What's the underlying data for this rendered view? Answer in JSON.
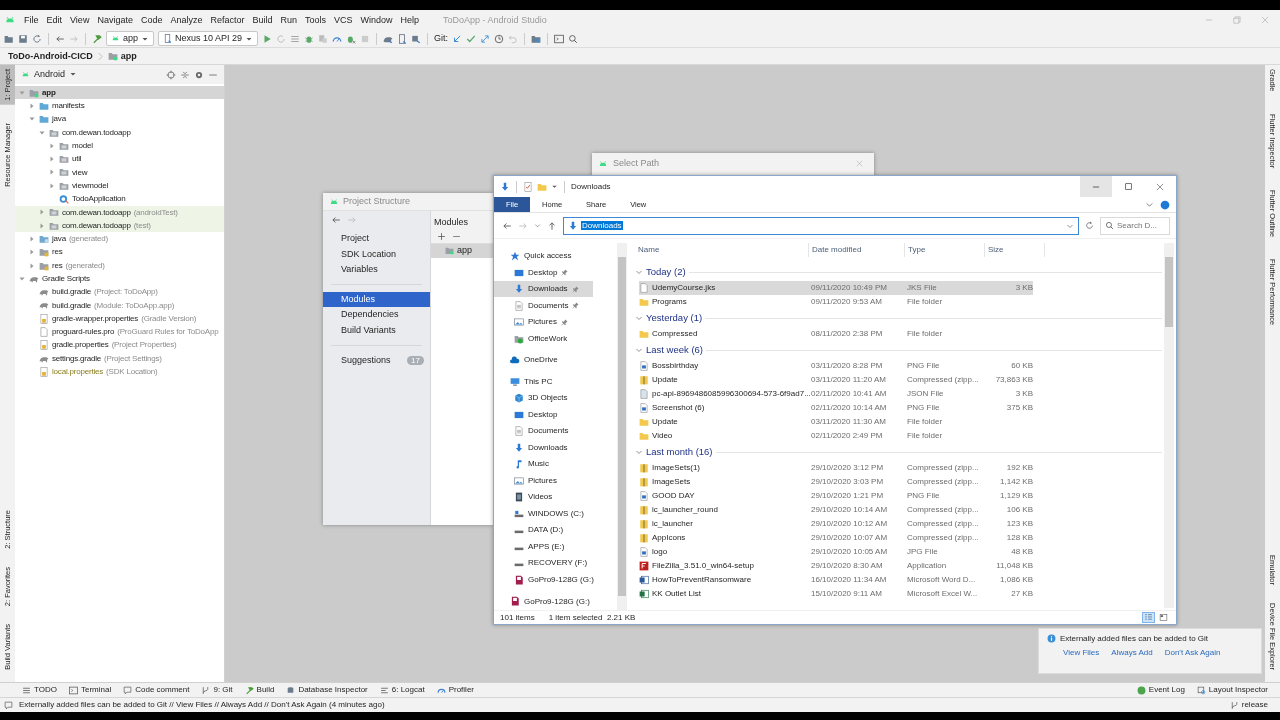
{
  "window": {
    "title": "ToDoApp - Android Studio"
  },
  "menu": [
    "File",
    "Edit",
    "View",
    "Navigate",
    "Code",
    "Analyze",
    "Refactor",
    "Build",
    "Run",
    "Tools",
    "VCS",
    "Window",
    "Help"
  ],
  "toolbar": {
    "config": "app",
    "device": "Nexus 10 API 29",
    "git_label": "Git:"
  },
  "breadcrumb": [
    "ToDo-Android-CICD",
    "app"
  ],
  "left_tabs": {
    "top": [
      {
        "label": "1: Project",
        "selected": true
      },
      {
        "label": "Resource Manager",
        "selected": false
      }
    ],
    "bottom": [
      {
        "label": "2: Structure",
        "selected": false
      },
      {
        "label": "2: Favorites",
        "selected": false
      },
      {
        "label": "Build Variants",
        "selected": false
      }
    ]
  },
  "right_tabs": {
    "top": [
      {
        "label": "Gradle"
      },
      {
        "label": "Flutter Inspector"
      },
      {
        "label": "Flutter Outline"
      },
      {
        "label": "Flutter Performance"
      }
    ],
    "bottom": [
      {
        "label": "Emulator"
      },
      {
        "label": "Device File Explorer"
      }
    ]
  },
  "project": {
    "view": "Android",
    "tree": [
      {
        "label": "app",
        "kind": "module",
        "expanded": true,
        "selected": true,
        "children": [
          {
            "label": "manifests",
            "kind": "folder",
            "expanded": false,
            "selected": false
          },
          {
            "label": "java",
            "kind": "folder",
            "expanded": true,
            "selected": false,
            "children": [
              {
                "label": "com.dewan.todoapp",
                "kind": "package",
                "expanded": true,
                "selected": false,
                "children": [
                  {
                    "label": "model",
                    "kind": "package",
                    "expanded": false,
                    "selected": false
                  },
                  {
                    "label": "util",
                    "kind": "package",
                    "expanded": false,
                    "selected": false
                  },
                  {
                    "label": "view",
                    "kind": "package",
                    "expanded": false,
                    "selected": false
                  },
                  {
                    "label": "viewmodel",
                    "kind": "package",
                    "expanded": false,
                    "selected": false
                  },
                  {
                    "label": "TodoApplication",
                    "kind": "class",
                    "selected": false
                  }
                ]
              },
              {
                "label": "com.dewan.todoapp",
                "note": "(androidTest)",
                "kind": "test-package",
                "expanded": false,
                "selected": false
              },
              {
                "label": "com.dewan.todoapp",
                "note": "(test)",
                "kind": "test-package",
                "expanded": false,
                "selected": false
              }
            ]
          },
          {
            "label": "java",
            "note": "(generated)",
            "kind": "generated",
            "expanded": false,
            "selected": false
          },
          {
            "label": "res",
            "kind": "res",
            "expanded": false,
            "selected": false
          },
          {
            "label": "res",
            "note": "(generated)",
            "kind": "res",
            "expanded": false,
            "selected": false
          }
        ]
      },
      {
        "label": "Gradle Scripts",
        "kind": "gradle",
        "expanded": true,
        "selected": false,
        "children": [
          {
            "label": "build.gradle",
            "note": "(Project: ToDoApp)",
            "kind": "gradle",
            "selected": false
          },
          {
            "label": "build.gradle",
            "note": "(Module: ToDoApp.app)",
            "kind": "gradle",
            "selected": false
          },
          {
            "label": "gradle-wrapper.properties",
            "note": "(Gradle Version)",
            "kind": "properties",
            "selected": false
          },
          {
            "label": "proguard-rules.pro",
            "note": "(ProGuard Rules for ToDoApp",
            "kind": "file",
            "selected": false
          },
          {
            "label": "gradle.properties",
            "note": "(Project Properties)",
            "kind": "properties",
            "selected": false
          },
          {
            "label": "settings.gradle",
            "note": "(Project Settings)",
            "kind": "gradle",
            "selected": false
          },
          {
            "label": "local.properties",
            "note": "(SDK Location)",
            "kind": "local-properties",
            "selected": false
          }
        ]
      }
    ]
  },
  "project_structure": {
    "title": "Project Structure",
    "items": [
      {
        "label": "Project",
        "selected": false,
        "separator_before": false
      },
      {
        "label": "SDK Location",
        "selected": false,
        "separator_before": false
      },
      {
        "label": "Variables",
        "selected": false,
        "separator_before": false
      },
      {
        "label": "Modules",
        "selected": true,
        "separator_before": true
      },
      {
        "label": "Dependencies",
        "selected": false,
        "separator_before": false
      },
      {
        "label": "Build Variants",
        "selected": false,
        "separator_before": false
      },
      {
        "label": "Suggestions",
        "selected": false,
        "separator_before": true,
        "badge": "17"
      }
    ],
    "modules_header": "Modules",
    "modules": [
      {
        "label": "app",
        "selected": true
      }
    ]
  },
  "select_path": {
    "title": "Select Path"
  },
  "explorer": {
    "title": "Downloads",
    "ribbon": [
      {
        "label": "File",
        "selected": true
      },
      {
        "label": "Home",
        "selected": false
      },
      {
        "label": "Share",
        "selected": false
      },
      {
        "label": "View",
        "selected": false
      }
    ],
    "address": "Downloads",
    "search": {
      "placeholder": "Search D..."
    },
    "nav": [
      {
        "label": "Quick access",
        "kind": "star",
        "selected": false,
        "children": [
          {
            "label": "Desktop",
            "kind": "desktop",
            "pinned": true,
            "selected": false
          },
          {
            "label": "Downloads",
            "kind": "download",
            "pinned": true,
            "selected": true
          },
          {
            "label": "Documents",
            "kind": "documents",
            "pinned": true,
            "selected": false
          },
          {
            "label": "Pictures",
            "kind": "pictures",
            "pinned": true,
            "selected": false
          },
          {
            "label": "OfficeWork",
            "kind": "shared-folder",
            "pinned": false,
            "selected": false
          }
        ]
      },
      {
        "label": "OneDrive",
        "kind": "cloud",
        "selected": false
      },
      {
        "label": "This PC",
        "kind": "pc",
        "selected": false,
        "children": [
          {
            "label": "3D Objects",
            "kind": "cube",
            "selected": false
          },
          {
            "label": "Desktop",
            "kind": "desktop",
            "selected": false
          },
          {
            "label": "Documents",
            "kind": "documents",
            "selected": false
          },
          {
            "label": "Downloads",
            "kind": "download",
            "selected": false
          },
          {
            "label": "Music",
            "kind": "music",
            "selected": false
          },
          {
            "label": "Pictures",
            "kind": "pictures",
            "selected": false
          },
          {
            "label": "Videos",
            "kind": "video",
            "selected": false
          },
          {
            "label": "WINDOWS (C:)",
            "kind": "os-drive",
            "selected": false
          },
          {
            "label": "DATA (D:)",
            "kind": "drive",
            "selected": false
          },
          {
            "label": "APPS (E:)",
            "kind": "drive",
            "selected": false
          },
          {
            "label": "RECOVERY (F:)",
            "kind": "drive",
            "selected": false
          },
          {
            "label": "GoPro9-128G (G:)",
            "kind": "sd",
            "selected": false
          }
        ]
      },
      {
        "label": "GoPro9-128G (G:)",
        "kind": "sd",
        "selected": false
      }
    ],
    "columns": [
      "Name",
      "Date modified",
      "Type",
      "Size"
    ],
    "groups": [
      {
        "title": "Today (2)",
        "expanded": true,
        "files": [
          {
            "name": "UdemyCourse.jks",
            "kind": "file",
            "date": "09/11/2020 10:49 PM",
            "type": "JKS File",
            "size": "3 KB",
            "selected": true
          },
          {
            "name": "Programs",
            "kind": "folder",
            "date": "09/11/2020 9:53 AM",
            "type": "File folder",
            "selected": false
          }
        ]
      },
      {
        "title": "Yesterday (1)",
        "expanded": true,
        "files": [
          {
            "name": "Compressed",
            "kind": "folder",
            "date": "08/11/2020 2:38 PM",
            "type": "File folder",
            "selected": false
          }
        ]
      },
      {
        "title": "Last week (6)",
        "expanded": true,
        "files": [
          {
            "name": "Bossbirthday",
            "kind": "image",
            "date": "03/11/2020 8:28 PM",
            "type": "PNG File",
            "size": "60 KB",
            "selected": false
          },
          {
            "name": "Update",
            "kind": "zip",
            "date": "03/11/2020 11:20 AM",
            "type": "Compressed (zipp...",
            "size": "73,863 KB",
            "selected": false
          },
          {
            "name": "pc-api-8969486085996300694-573-6f9ad7...",
            "kind": "json",
            "date": "02/11/2020 10:41 AM",
            "type": "JSON File",
            "size": "3 KB",
            "selected": false
          },
          {
            "name": "Screenshot (6)",
            "kind": "image",
            "date": "02/11/2020 10:14 AM",
            "type": "PNG File",
            "size": "375 KB",
            "selected": false
          },
          {
            "name": "Update",
            "kind": "folder",
            "date": "03/11/2020 11:30 AM",
            "type": "File folder",
            "selected": false
          },
          {
            "name": "Video",
            "kind": "folder",
            "date": "02/11/2020 2:49 PM",
            "type": "File folder",
            "selected": false
          }
        ]
      },
      {
        "title": "Last month (16)",
        "expanded": true,
        "files": [
          {
            "name": "ImageSets(1)",
            "kind": "zip",
            "date": "29/10/2020 3:12 PM",
            "type": "Compressed (zipp...",
            "size": "192 KB",
            "selected": false
          },
          {
            "name": "ImageSets",
            "kind": "zip",
            "date": "29/10/2020 3:03 PM",
            "type": "Compressed (zipp...",
            "size": "1,142 KB",
            "selected": false
          },
          {
            "name": "GOOD DAY",
            "kind": "image",
            "date": "29/10/2020 1:21 PM",
            "type": "PNG File",
            "size": "1,129 KB",
            "selected": false
          },
          {
            "name": "ic_launcher_round",
            "kind": "zip",
            "date": "29/10/2020 10:14 AM",
            "type": "Compressed (zipp...",
            "size": "106 KB",
            "selected": false
          },
          {
            "name": "ic_launcher",
            "kind": "zip",
            "date": "29/10/2020 10:12 AM",
            "type": "Compressed (zipp...",
            "size": "123 KB",
            "selected": false
          },
          {
            "name": "AppIcons",
            "kind": "zip",
            "date": "29/10/2020 10:07 AM",
            "type": "Compressed (zipp...",
            "size": "128 KB",
            "selected": false
          },
          {
            "name": "logo",
            "kind": "image",
            "date": "29/10/2020 10:05 AM",
            "type": "JPG File",
            "size": "48 KB",
            "selected": false
          },
          {
            "name": "FileZilla_3.51.0_win64-setup",
            "kind": "app",
            "date": "29/10/2020 8:30 AM",
            "type": "Application",
            "size": "11,048 KB",
            "selected": false
          },
          {
            "name": "HowToPreventRansomware",
            "kind": "word",
            "date": "16/10/2020 11:34 AM",
            "type": "Microsoft Word D...",
            "size": "1,086 KB",
            "selected": false
          },
          {
            "name": "KK Outlet List",
            "kind": "excel",
            "date": "15/10/2020 9:11 AM",
            "type": "Microsoft Excel W...",
            "size": "27 KB",
            "selected": false
          }
        ]
      }
    ],
    "status": {
      "count": "101 items",
      "selection": "1 item selected  2.21 KB"
    },
    "views": [
      {
        "kind": "details",
        "selected": true
      },
      {
        "kind": "tiles",
        "selected": false
      }
    ]
  },
  "notification": {
    "text": "Externally added files can be added to Git",
    "links": [
      "View Files",
      "Always Add",
      "Don't Ask Again"
    ]
  },
  "tool_tabs": {
    "left": [
      {
        "label": "TODO",
        "kind": "todo"
      },
      {
        "label": "Terminal",
        "kind": "terminal"
      },
      {
        "label": "Code comment",
        "kind": "comment"
      },
      {
        "label": "9: Git",
        "kind": "git"
      },
      {
        "label": "Build",
        "kind": "build"
      },
      {
        "label": "Database Inspector",
        "kind": "database"
      },
      {
        "label": "6: Logcat",
        "kind": "logcat"
      },
      {
        "label": "Profiler",
        "kind": "profiler"
      }
    ],
    "right": [
      {
        "label": "Event Log",
        "kind": "event"
      },
      {
        "label": "Layout Inspector",
        "kind": "inspector"
      }
    ]
  },
  "status_bar": {
    "message": "Externally added files can be added to Git // View Files // Always Add // Don't Ask Again (4 minutes ago)",
    "branch": "release"
  }
}
